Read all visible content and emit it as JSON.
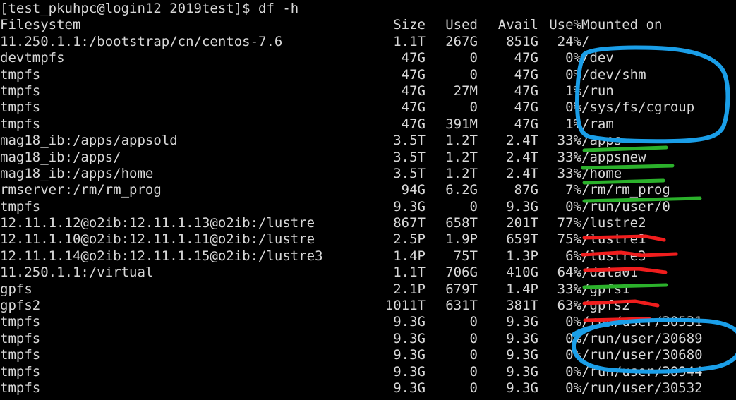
{
  "terminal": {
    "prompt_line": "[test_pkuhpc@login12 2019test]$ df -h",
    "prompt_user_host": "test_pkuhpc@login12",
    "prompt_cwd": "2019test",
    "command": "df -h",
    "background_color": "#000000",
    "text_color": "#d8d8d8"
  },
  "table": {
    "headers": {
      "filesystem": "Filesystem",
      "size": "Size",
      "used": "Used",
      "avail": "Avail",
      "use_pct": "Use%",
      "mounted_on": "Mounted on"
    },
    "rows": [
      {
        "filesystem": "11.250.1.1:/bootstrap/cn/centos-7.6",
        "size": "1.1T",
        "used": "267G",
        "avail": "851G",
        "use_pct": "24%",
        "mounted_on": "/"
      },
      {
        "filesystem": "devtmpfs",
        "size": "47G",
        "used": "0",
        "avail": "47G",
        "use_pct": "0%",
        "mounted_on": "/dev"
      },
      {
        "filesystem": "tmpfs",
        "size": "47G",
        "used": "0",
        "avail": "47G",
        "use_pct": "0%",
        "mounted_on": "/dev/shm"
      },
      {
        "filesystem": "tmpfs",
        "size": "47G",
        "used": "27M",
        "avail": "47G",
        "use_pct": "1%",
        "mounted_on": "/run"
      },
      {
        "filesystem": "tmpfs",
        "size": "47G",
        "used": "0",
        "avail": "47G",
        "use_pct": "0%",
        "mounted_on": "/sys/fs/cgroup"
      },
      {
        "filesystem": "tmpfs",
        "size": "47G",
        "used": "391M",
        "avail": "47G",
        "use_pct": "1%",
        "mounted_on": "/ram"
      },
      {
        "filesystem": "mag18_ib:/apps/appsold",
        "size": "3.5T",
        "used": "1.2T",
        "avail": "2.4T",
        "use_pct": "33%",
        "mounted_on": "/apps"
      },
      {
        "filesystem": "mag18_ib:/apps/",
        "size": "3.5T",
        "used": "1.2T",
        "avail": "2.4T",
        "use_pct": "33%",
        "mounted_on": "/appsnew"
      },
      {
        "filesystem": "mag18_ib:/apps/home",
        "size": "3.5T",
        "used": "1.2T",
        "avail": "2.4T",
        "use_pct": "33%",
        "mounted_on": "/home"
      },
      {
        "filesystem": "rmserver:/rm/rm_prog",
        "size": "94G",
        "used": "6.2G",
        "avail": "87G",
        "use_pct": "7%",
        "mounted_on": "/rm/rm_prog"
      },
      {
        "filesystem": "tmpfs",
        "size": "9.3G",
        "used": "0",
        "avail": "9.3G",
        "use_pct": "0%",
        "mounted_on": "/run/user/0"
      },
      {
        "filesystem": "12.11.1.12@o2ib:12.11.1.13@o2ib:/lustre",
        "size": "867T",
        "used": "658T",
        "avail": "201T",
        "use_pct": "77%",
        "mounted_on": "/lustre2"
      },
      {
        "filesystem": "12.11.1.10@o2ib:12.11.1.11@o2ib:/lustre",
        "size": "2.5P",
        "used": "1.9P",
        "avail": "659T",
        "use_pct": "75%",
        "mounted_on": "/lustre1"
      },
      {
        "filesystem": "12.11.1.14@o2ib:12.11.1.15@o2ib:/lustre3",
        "size": "1.4P",
        "used": "75T",
        "avail": "1.3P",
        "use_pct": "6%",
        "mounted_on": "/lustre3"
      },
      {
        "filesystem": "11.250.1.1:/virtual",
        "size": "1.1T",
        "used": "706G",
        "avail": "410G",
        "use_pct": "64%",
        "mounted_on": "/data01"
      },
      {
        "filesystem": "gpfs",
        "size": "2.1P",
        "used": "679T",
        "avail": "1.4P",
        "use_pct": "33%",
        "mounted_on": "/gpfs1"
      },
      {
        "filesystem": "gpfs2",
        "size": "1011T",
        "used": "631T",
        "avail": "381T",
        "use_pct": "63%",
        "mounted_on": "/gpfs2"
      },
      {
        "filesystem": "tmpfs",
        "size": "9.3G",
        "used": "0",
        "avail": "9.3G",
        "use_pct": "0%",
        "mounted_on": "/run/user/30531"
      },
      {
        "filesystem": "tmpfs",
        "size": "9.3G",
        "used": "0",
        "avail": "9.3G",
        "use_pct": "0%",
        "mounted_on": "/run/user/30689"
      },
      {
        "filesystem": "tmpfs",
        "size": "9.3G",
        "used": "0",
        "avail": "9.3G",
        "use_pct": "0%",
        "mounted_on": "/run/user/30680"
      },
      {
        "filesystem": "tmpfs",
        "size": "9.3G",
        "used": "0",
        "avail": "9.3G",
        "use_pct": "0%",
        "mounted_on": "/run/user/30944"
      },
      {
        "filesystem": "tmpfs",
        "size": "9.3G",
        "used": "0",
        "avail": "9.3G",
        "use_pct": "0%",
        "mounted_on": "/run/user/30532"
      }
    ]
  },
  "annotations": {
    "colors": {
      "blue": "#1a9ee8",
      "green": "#2bb12b",
      "red": "#f01d1d"
    },
    "green_underlines": [
      "/appsnew",
      "/home",
      "/rm/rm_prog",
      "/data01"
    ],
    "red_underlines": [
      "/lustre2",
      "/lustre1",
      "/lustre3",
      "/gpfs1",
      "/gpfs2"
    ],
    "blue_circles": [
      {
        "label": "top-circle-dev-ram",
        "encloses": [
          "/dev",
          "/dev/shm",
          "/run",
          "/sys/fs/cgroup",
          "/ram"
        ]
      },
      {
        "label": "bottom-circle-run-user",
        "encloses": [
          "/run/user/30531",
          "/run/user/30689",
          "/run/user/30680"
        ]
      }
    ]
  }
}
